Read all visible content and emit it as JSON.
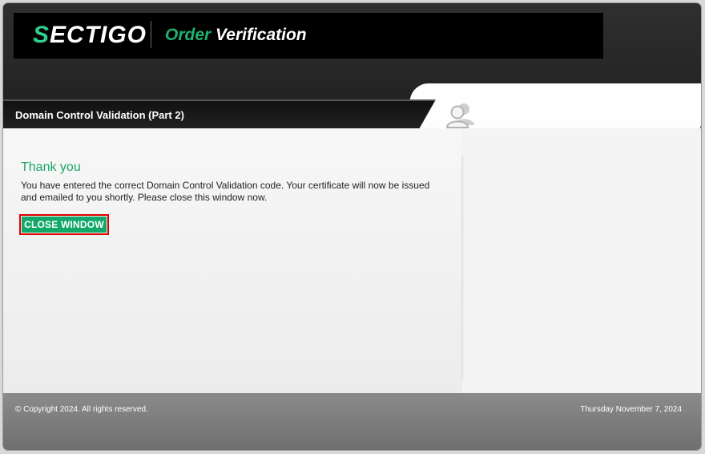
{
  "header": {
    "logo_text": "ECTIGO",
    "logo_s": "S",
    "tagline_accent": "Order",
    "tagline_rest": "Verification"
  },
  "page": {
    "title": "Domain Control Validation (Part 2)"
  },
  "content": {
    "heading": "Thank you",
    "message": "You have entered the correct Domain Control Validation code. Your certificate will now be issued and emailed to you shortly. Please close this window now.",
    "close_button": "CLOSE WINDOW"
  },
  "footer": {
    "copyright": "© Copyright 2024. All rights reserved.",
    "date": "Thursday November 7, 2024"
  },
  "colors": {
    "brand_green": "#1aa56a",
    "header_dark": "#1c1c1c"
  },
  "icons": [
    "users-icon"
  ]
}
